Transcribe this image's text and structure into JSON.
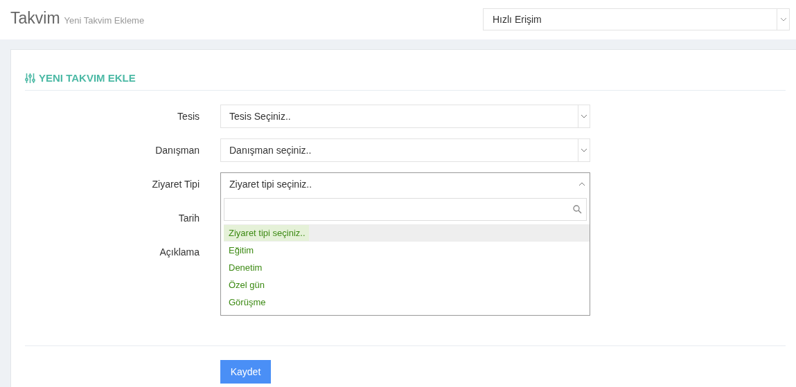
{
  "header": {
    "title": "Takvim",
    "subtitle": "Yeni Takvim Ekleme",
    "quick_access": {
      "value": "Hızlı Erişim"
    }
  },
  "card": {
    "title": "YENI TAKVIM EKLE"
  },
  "form": {
    "fields": [
      {
        "label": "Tesis",
        "kind": "select",
        "value": "Tesis Seçiniz..",
        "expanded": false
      },
      {
        "label": "Danışman",
        "kind": "select",
        "value": "Danışman seçiniz..",
        "expanded": false
      },
      {
        "label": "Ziyaret Tipi",
        "kind": "select",
        "value": "Ziyaret tipi seçiniz..",
        "expanded": true
      },
      {
        "label": "Tarih",
        "kind": "hidden"
      },
      {
        "label": "Açıklama",
        "kind": "hidden"
      }
    ],
    "dropdown": {
      "options": [
        {
          "label": "Ziyaret tipi seçiniz..",
          "selected": true
        },
        {
          "label": "Eğitim",
          "selected": false
        },
        {
          "label": "Denetim",
          "selected": false
        },
        {
          "label": "Özel gün",
          "selected": false
        },
        {
          "label": "Görüşme",
          "selected": false
        }
      ]
    },
    "submit": "Kaydet"
  }
}
